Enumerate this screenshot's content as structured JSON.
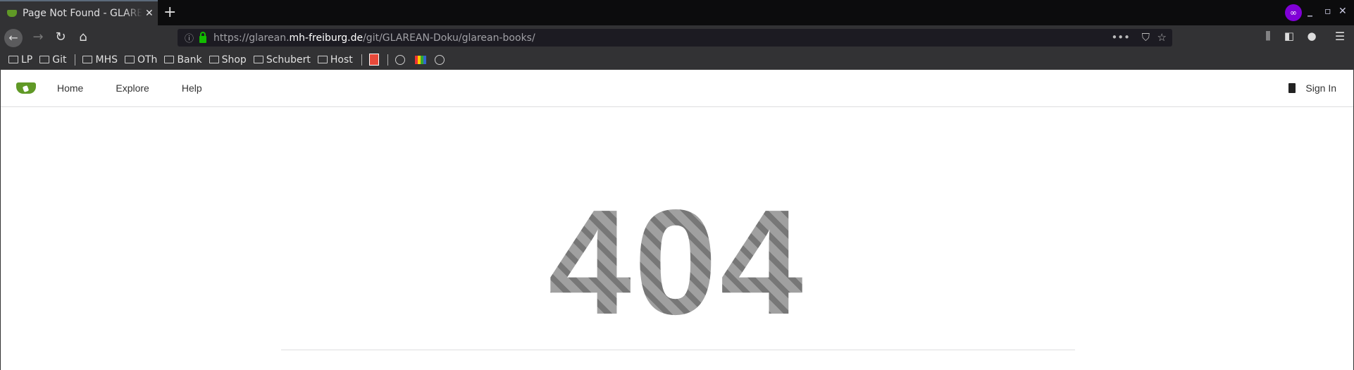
{
  "browser": {
    "tab_title": "Page Not Found - GLAREAN",
    "url_scheme_prefix": "https://glarean.",
    "url_host": "mh-freiburg.de",
    "url_path": "/git/GLAREAN-Doku/glarean-books/",
    "private_badge_color": "#8000d7",
    "bookmarks": [
      {
        "label": "LP"
      },
      {
        "label": "Git"
      },
      {
        "label": "MHS"
      },
      {
        "label": "OTh"
      },
      {
        "label": "Bank"
      },
      {
        "label": "Shop"
      },
      {
        "label": "Schubert"
      },
      {
        "label": "Host"
      }
    ]
  },
  "site": {
    "brand_color": "#609926",
    "nav": [
      {
        "label": "Home"
      },
      {
        "label": "Explore"
      },
      {
        "label": "Help"
      }
    ],
    "sign_in": "Sign In"
  },
  "main": {
    "error_code": "404"
  }
}
